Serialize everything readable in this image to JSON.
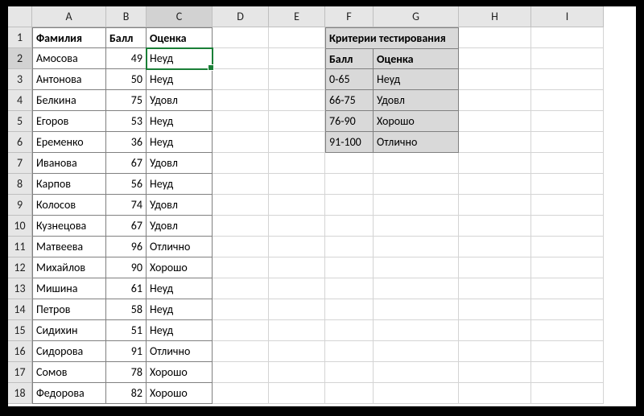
{
  "columns": [
    "A",
    "B",
    "C",
    "D",
    "E",
    "F",
    "G",
    "H",
    "I"
  ],
  "row_count": 18,
  "active_cell": "C2",
  "headers": {
    "A": "Фамилия",
    "B": "Балл",
    "C": "Оценка"
  },
  "main": [
    {
      "name": "Амосова",
      "score": 49,
      "grade": "Неуд"
    },
    {
      "name": "Антонова",
      "score": 50,
      "grade": "Неуд"
    },
    {
      "name": "Белкина",
      "score": 75,
      "grade": "Удовл"
    },
    {
      "name": "Егоров",
      "score": 53,
      "grade": "Неуд"
    },
    {
      "name": "Еременко",
      "score": 36,
      "grade": "Неуд"
    },
    {
      "name": "Иванова",
      "score": 67,
      "grade": "Удовл"
    },
    {
      "name": "Карпов",
      "score": 56,
      "grade": "Неуд"
    },
    {
      "name": "Колосов",
      "score": 74,
      "grade": "Удовл"
    },
    {
      "name": "Кузнецова",
      "score": 67,
      "grade": "Удовл"
    },
    {
      "name": "Матвеева",
      "score": 96,
      "grade": "Отлично"
    },
    {
      "name": "Михайлов",
      "score": 90,
      "grade": "Хорошо"
    },
    {
      "name": "Мишина",
      "score": 61,
      "grade": "Неуд"
    },
    {
      "name": "Петров",
      "score": 58,
      "grade": "Неуд"
    },
    {
      "name": "Сидихин",
      "score": 51,
      "grade": "Неуд"
    },
    {
      "name": "Сидорова",
      "score": 91,
      "grade": "Отлично"
    },
    {
      "name": "Сомов",
      "score": 78,
      "grade": "Хорошо"
    },
    {
      "name": "Федорова",
      "score": 82,
      "grade": "Хорошо"
    }
  ],
  "criteria": {
    "title": "Критерии тестирования",
    "head_score": "Балл",
    "head_grade": "Оценка",
    "rows": [
      {
        "range": "0-65",
        "grade": "Неуд"
      },
      {
        "range": "66-75",
        "grade": "Удовл"
      },
      {
        "range": "76-90",
        "grade": "Хорошо"
      },
      {
        "range": "91-100",
        "grade": "Отлично"
      }
    ]
  }
}
